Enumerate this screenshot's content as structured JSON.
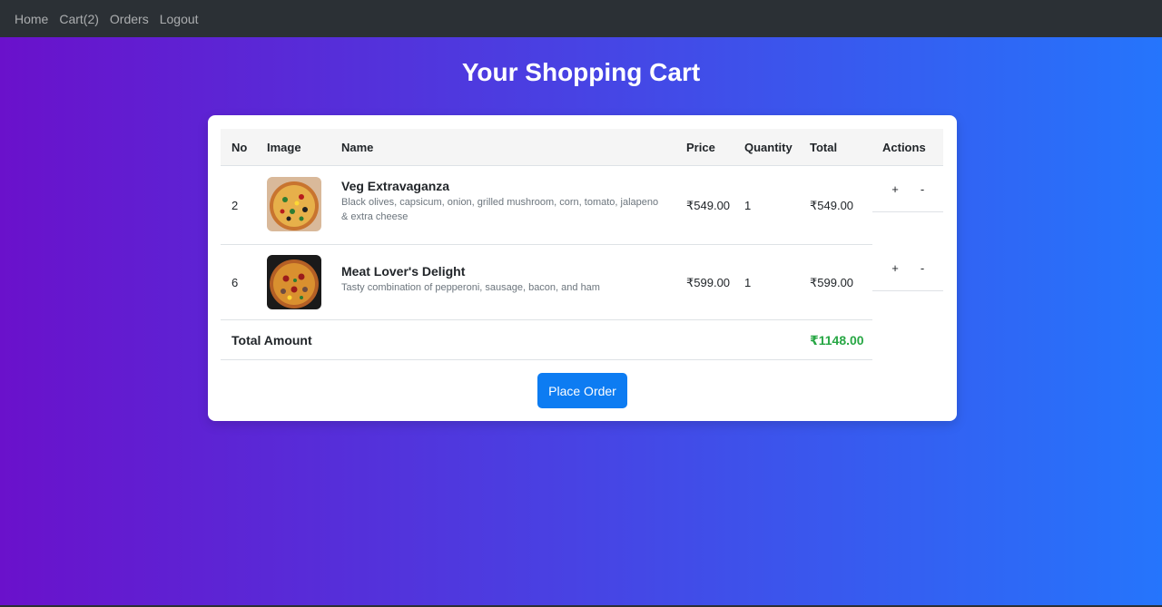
{
  "nav": {
    "home": "Home",
    "cart": "Cart(2)",
    "orders": "Orders",
    "logout": "Logout"
  },
  "page_title": "Your Shopping Cart",
  "table": {
    "headers": [
      "No",
      "Image",
      "Name",
      "Price",
      "Quantity",
      "Total",
      "Actions"
    ],
    "rows": [
      {
        "no": "2",
        "name": "Veg Extravaganza",
        "description": "Black olives, capsicum, onion, grilled mushroom, corn, tomato, jalapeno & extra cheese",
        "price": "₹549.00",
        "quantity": "1",
        "total": "₹549.00",
        "increase": "+",
        "decrease": "-",
        "image_icon": "pizza-veg-image"
      },
      {
        "no": "6",
        "name": "Meat Lover's Delight",
        "description": "Tasty combination of pepperoni, sausage, bacon, and ham",
        "price": "₹599.00",
        "quantity": "1",
        "total": "₹599.00",
        "increase": "+",
        "decrease": "-",
        "image_icon": "pizza-meat-image"
      }
    ],
    "total_label": "Total Amount",
    "total_value": "₹1148.00"
  },
  "place_order_label": "Place Order",
  "colors": {
    "gradient_start": "#6a11cb",
    "gradient_end": "#2575fc",
    "navbar": "#2b3035",
    "primary_button": "#0d7cf2",
    "total_green": "#28a745"
  }
}
